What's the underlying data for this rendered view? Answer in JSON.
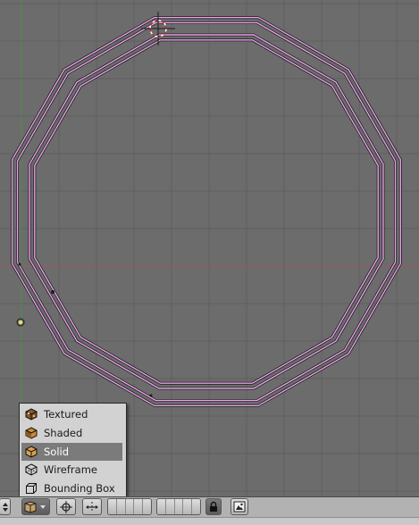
{
  "viewport": {
    "background": "#6c6c6c",
    "grid_color": "#5f5f5f",
    "x_axis_color": "#9a5a5a",
    "y_axis_color": "#4e8a4e",
    "outline_color": "#e8a2e8",
    "object": {
      "type": "tube",
      "sides": 12,
      "rings": 2,
      "selected": true
    },
    "cursor_icon": "3d-cursor-icon",
    "object_center_icon": "object-center-icon"
  },
  "draw_type_menu": {
    "items": [
      {
        "label": "Textured",
        "icon": "textured-icon",
        "active": false
      },
      {
        "label": "Shaded",
        "icon": "shaded-icon",
        "active": false
      },
      {
        "label": "Solid",
        "icon": "solid-icon",
        "active": true
      },
      {
        "label": "Wireframe",
        "icon": "wireframe-icon",
        "active": false
      },
      {
        "label": "Bounding Box",
        "icon": "bounding-box-icon",
        "active": false
      }
    ]
  },
  "header": {
    "buttons": [
      "menu-arrows-icon",
      "draw-type-icon",
      "pivot-icon",
      "manipulator-icon",
      "layers-icon",
      "lock-icon",
      "render-icon"
    ]
  }
}
